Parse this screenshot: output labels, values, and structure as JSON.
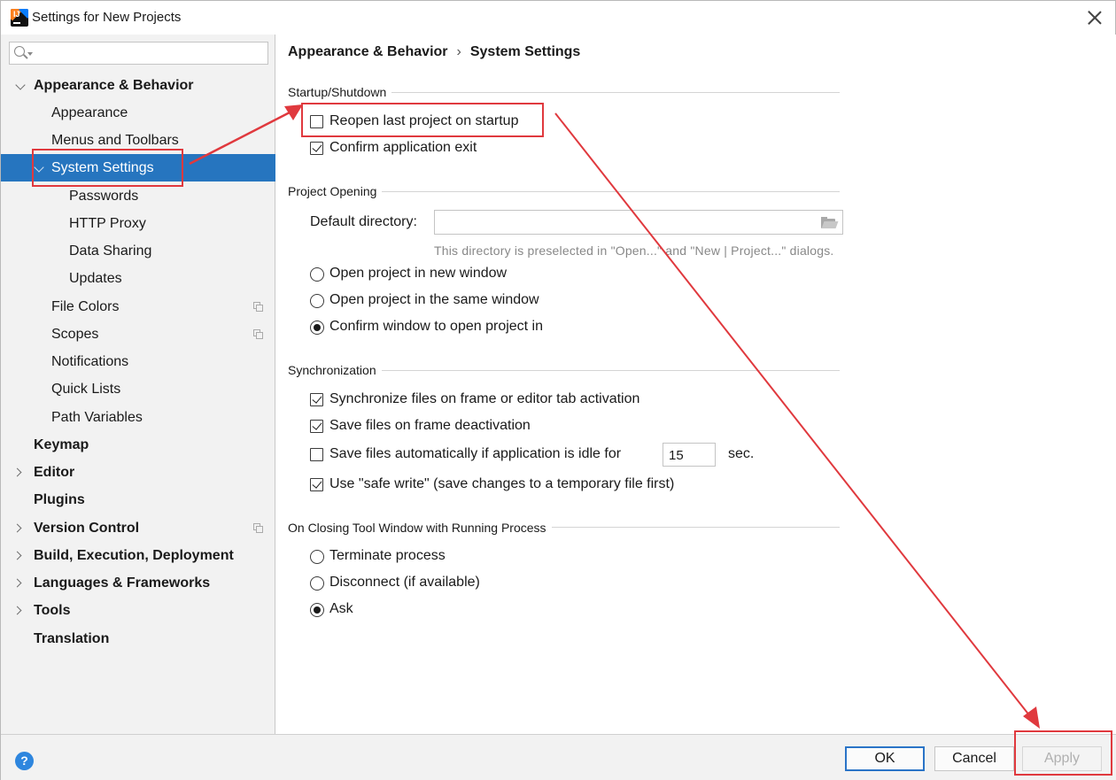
{
  "window": {
    "title": "Settings for New Projects"
  },
  "sidebar": {
    "search_placeholder": "",
    "items": [
      {
        "label": "Appearance & Behavior"
      },
      {
        "label": "Appearance"
      },
      {
        "label": "Menus and Toolbars"
      },
      {
        "label": "System Settings"
      },
      {
        "label": "Passwords"
      },
      {
        "label": "HTTP Proxy"
      },
      {
        "label": "Data Sharing"
      },
      {
        "label": "Updates"
      },
      {
        "label": "File Colors"
      },
      {
        "label": "Scopes"
      },
      {
        "label": "Notifications"
      },
      {
        "label": "Quick Lists"
      },
      {
        "label": "Path Variables"
      },
      {
        "label": "Keymap"
      },
      {
        "label": "Editor"
      },
      {
        "label": "Plugins"
      },
      {
        "label": "Version Control"
      },
      {
        "label": "Build, Execution, Deployment"
      },
      {
        "label": "Languages & Frameworks"
      },
      {
        "label": "Tools"
      },
      {
        "label": "Translation"
      }
    ]
  },
  "breadcrumb": {
    "parent": "Appearance & Behavior",
    "separator": "›",
    "current": "System Settings"
  },
  "startup": {
    "title": "Startup/Shutdown",
    "reopen_last_project": {
      "label": "Reopen last project on startup",
      "checked": false
    },
    "confirm_exit": {
      "label": "Confirm application exit",
      "checked": true
    }
  },
  "project_opening": {
    "title": "Project Opening",
    "default_dir_label": "Default directory:",
    "default_dir_value": "",
    "hint": "This directory is preselected in \"Open...\" and \"New | Project...\" dialogs.",
    "options": [
      {
        "label": "Open project in new window",
        "checked": false
      },
      {
        "label": "Open project in the same window",
        "checked": false
      },
      {
        "label": "Confirm window to open project in",
        "checked": true
      }
    ]
  },
  "synchronization": {
    "title": "Synchronization",
    "sync_on_activation": {
      "label": "Synchronize files on frame or editor tab activation",
      "checked": true
    },
    "save_on_deactivation": {
      "label": "Save files on frame deactivation",
      "checked": true
    },
    "save_when_idle": {
      "label": "Save files automatically if application is idle for",
      "checked": false,
      "value": "15",
      "unit": "sec."
    },
    "safe_write": {
      "label": "Use \"safe write\" (save changes to a temporary file first)",
      "checked": true
    }
  },
  "closing_tool_window": {
    "title": "On Closing Tool Window with Running Process",
    "options": [
      {
        "label": "Terminate process",
        "checked": false
      },
      {
        "label": "Disconnect (if available)",
        "checked": false
      },
      {
        "label": "Ask",
        "checked": true
      }
    ]
  },
  "footer": {
    "help": "?",
    "ok": "OK",
    "cancel": "Cancel",
    "apply": "Apply"
  },
  "colors": {
    "selection": "#2675bf",
    "annotation": "#e0393e",
    "default_button_border": "#2a74c7"
  }
}
